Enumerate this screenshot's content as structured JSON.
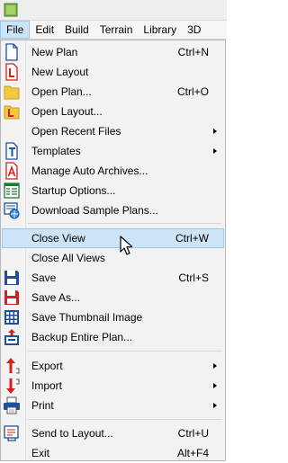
{
  "menubar": {
    "items": [
      "File",
      "Edit",
      "Build",
      "Terrain",
      "Library",
      "3D"
    ]
  },
  "file_menu": {
    "new_plan": {
      "label": "New Plan",
      "shortcut": "Ctrl+N"
    },
    "new_layout": {
      "label": "New Layout"
    },
    "open_plan": {
      "label": "Open Plan...",
      "shortcut": "Ctrl+O"
    },
    "open_layout": {
      "label": "Open Layout..."
    },
    "open_recent": {
      "label": "Open Recent Files"
    },
    "templates": {
      "label": "Templates"
    },
    "manage_archives": {
      "label": "Manage Auto Archives..."
    },
    "startup_options": {
      "label": "Startup Options..."
    },
    "download_samples": {
      "label": "Download Sample Plans..."
    },
    "close_view": {
      "label": "Close View",
      "shortcut": "Ctrl+W"
    },
    "close_all": {
      "label": "Close All Views"
    },
    "save": {
      "label": "Save",
      "shortcut": "Ctrl+S"
    },
    "save_as": {
      "label": "Save As..."
    },
    "save_thumbnail": {
      "label": "Save Thumbnail Image"
    },
    "backup": {
      "label": "Backup Entire Plan..."
    },
    "export": {
      "label": "Export"
    },
    "import": {
      "label": "Import"
    },
    "print": {
      "label": "Print"
    },
    "send_layout": {
      "label": "Send to Layout...",
      "shortcut": "Ctrl+U"
    },
    "exit": {
      "label": "Exit",
      "shortcut": "Alt+F4"
    }
  },
  "colors": {
    "highlight": "#cce4f7",
    "highlight_border": "#99c9ef",
    "menu_bg": "#f2f2f2",
    "icon_blue": "#1f4e9c",
    "icon_red": "#d42020",
    "folder_yellow": "#f5c842"
  }
}
